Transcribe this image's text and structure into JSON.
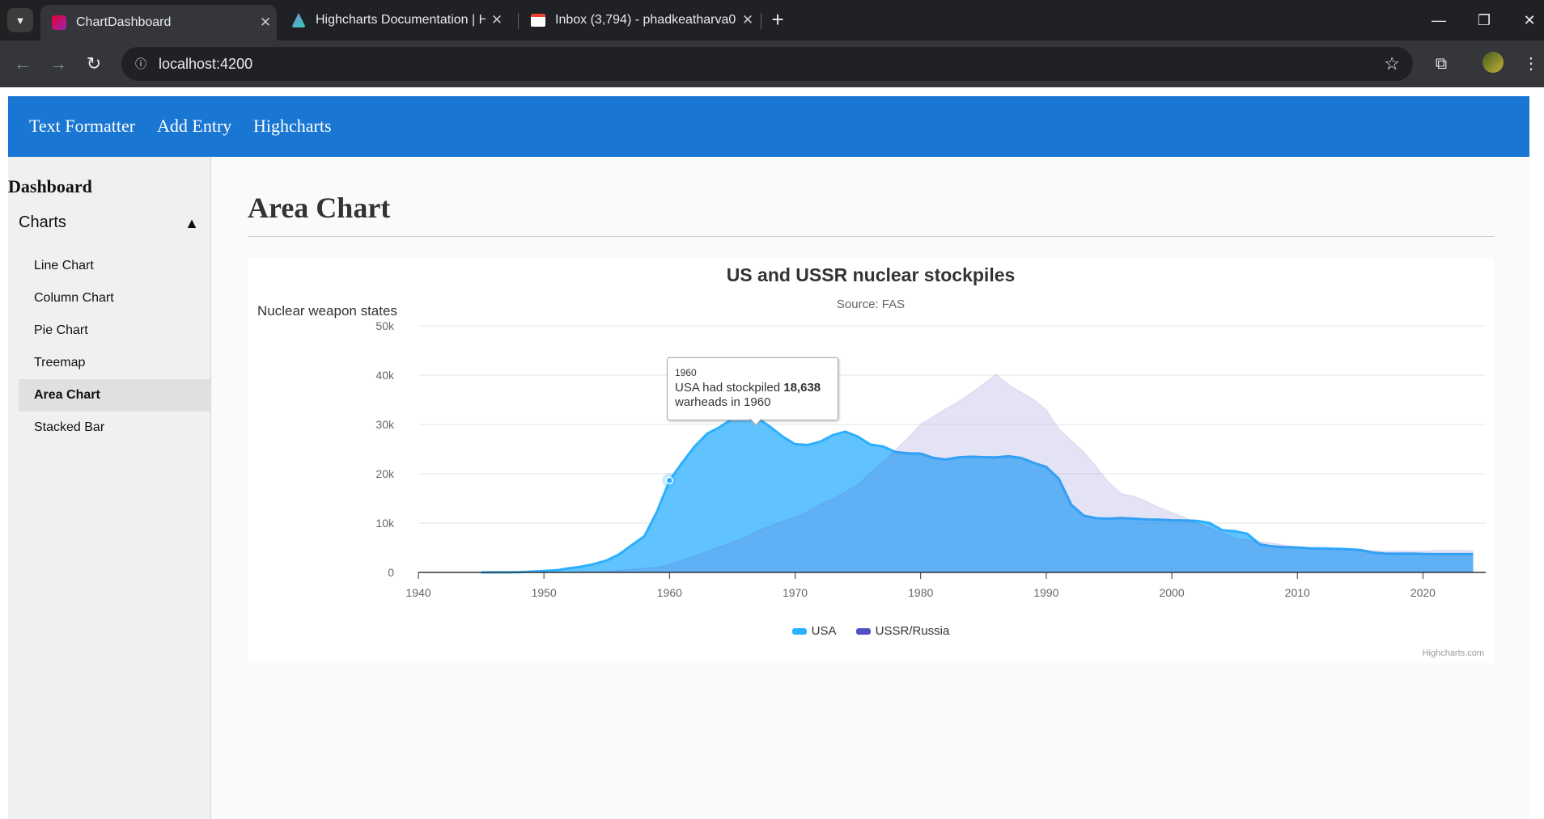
{
  "browser": {
    "tabs": [
      {
        "title": "ChartDashboard",
        "favicon": "angular-icon",
        "active": true
      },
      {
        "title": "Highcharts Documentation | Hi",
        "favicon": "highcharts-icon",
        "active": false
      },
      {
        "title": "Inbox (3,794) - phadkeatharva0",
        "favicon": "gmail-icon",
        "active": false
      }
    ],
    "url": "localhost:4200"
  },
  "nav": {
    "links": [
      "Text Formatter",
      "Add Entry",
      "Highcharts"
    ]
  },
  "sidebar": {
    "title": "Dashboard",
    "section": "Charts",
    "section_caret": "▲",
    "items": [
      {
        "label": "Line Chart"
      },
      {
        "label": "Column Chart"
      },
      {
        "label": "Pie Chart"
      },
      {
        "label": "Treemap"
      },
      {
        "label": "Area Chart",
        "active": true
      },
      {
        "label": "Stacked Bar"
      }
    ]
  },
  "main": {
    "page_title": "Area Chart"
  },
  "tooltip": {
    "header": "1960",
    "line1_prefix": "USA had stockpiled ",
    "line1_value": "18,638",
    "line2": "warheads in 1960"
  },
  "chart_data": {
    "type": "area",
    "title": "US and USSR nuclear stockpiles",
    "subtitle": "Source: FAS",
    "ylabel": "Nuclear weapon states",
    "xlim": [
      1940,
      2025
    ],
    "ylim": [
      0,
      50000
    ],
    "x_ticks": [
      1940,
      1950,
      1960,
      1970,
      1980,
      1990,
      2000,
      2010,
      2020
    ],
    "y_ticks": [
      0,
      10000,
      20000,
      30000,
      40000,
      50000
    ],
    "y_tick_labels": [
      "0",
      "10k",
      "20k",
      "30k",
      "40k",
      "50k"
    ],
    "grid": true,
    "legend": "bottom-center",
    "credits": "Highcharts.com",
    "series": [
      {
        "name": "USA",
        "color": "#2caffe",
        "data": [
          [
            1945,
            2
          ],
          [
            1946,
            9
          ],
          [
            1947,
            13
          ],
          [
            1948,
            50
          ],
          [
            1949,
            170
          ],
          [
            1950,
            298
          ],
          [
            1951,
            438
          ],
          [
            1952,
            841
          ],
          [
            1953,
            1169
          ],
          [
            1954,
            1703
          ],
          [
            1955,
            2422
          ],
          [
            1956,
            3692
          ],
          [
            1957,
            5543
          ],
          [
            1958,
            7345
          ],
          [
            1959,
            12298
          ],
          [
            1960,
            18638
          ],
          [
            1961,
            22229
          ],
          [
            1962,
            25540
          ],
          [
            1963,
            28133
          ],
          [
            1964,
            29463
          ],
          [
            1965,
            31139
          ],
          [
            1966,
            31175
          ],
          [
            1967,
            31255
          ],
          [
            1968,
            29561
          ],
          [
            1969,
            27552
          ],
          [
            1970,
            26008
          ],
          [
            1971,
            25830
          ],
          [
            1972,
            26516
          ],
          [
            1973,
            27835
          ],
          [
            1974,
            28537
          ],
          [
            1975,
            27519
          ],
          [
            1976,
            25914
          ],
          [
            1977,
            25542
          ],
          [
            1978,
            24418
          ],
          [
            1979,
            24138
          ],
          [
            1980,
            24104
          ],
          [
            1981,
            23208
          ],
          [
            1982,
            22886
          ],
          [
            1983,
            23305
          ],
          [
            1984,
            23459
          ],
          [
            1985,
            23368
          ],
          [
            1986,
            23317
          ],
          [
            1987,
            23575
          ],
          [
            1988,
            23205
          ],
          [
            1989,
            22217
          ],
          [
            1990,
            21392
          ],
          [
            1991,
            19008
          ],
          [
            1992,
            13708
          ],
          [
            1993,
            11511
          ],
          [
            1994,
            10979
          ],
          [
            1995,
            10904
          ],
          [
            1996,
            11011
          ],
          [
            1997,
            10903
          ],
          [
            1998,
            10732
          ],
          [
            1999,
            10685
          ],
          [
            2000,
            10577
          ],
          [
            2001,
            10526
          ],
          [
            2002,
            10457
          ],
          [
            2003,
            10027
          ],
          [
            2004,
            8570
          ],
          [
            2005,
            8360
          ],
          [
            2006,
            7853
          ],
          [
            2007,
            5709
          ],
          [
            2008,
            5273
          ],
          [
            2009,
            5113
          ],
          [
            2010,
            5066
          ],
          [
            2011,
            4897
          ],
          [
            2012,
            4881
          ],
          [
            2013,
            4804
          ],
          [
            2014,
            4717
          ],
          [
            2015,
            4571
          ],
          [
            2016,
            4018
          ],
          [
            2017,
            3822
          ],
          [
            2018,
            3785
          ],
          [
            2019,
            3805
          ],
          [
            2020,
            3750
          ],
          [
            2021,
            3708
          ],
          [
            2022,
            3708
          ],
          [
            2023,
            3708
          ],
          [
            2024,
            3708
          ]
        ]
      },
      {
        "name": "USSR/Russia",
        "color": "#544fc5",
        "data": [
          [
            1945,
            0
          ],
          [
            1946,
            0
          ],
          [
            1947,
            0
          ],
          [
            1948,
            0
          ],
          [
            1949,
            1
          ],
          [
            1950,
            5
          ],
          [
            1951,
            25
          ],
          [
            1952,
            50
          ],
          [
            1953,
            120
          ],
          [
            1954,
            150
          ],
          [
            1955,
            200
          ],
          [
            1956,
            426
          ],
          [
            1957,
            660
          ],
          [
            1958,
            863
          ],
          [
            1959,
            1048
          ],
          [
            1960,
            1627
          ],
          [
            1961,
            2492
          ],
          [
            1962,
            3346
          ],
          [
            1963,
            4259
          ],
          [
            1964,
            5242
          ],
          [
            1965,
            6144
          ],
          [
            1966,
            7091
          ],
          [
            1967,
            8400
          ],
          [
            1968,
            9417
          ],
          [
            1969,
            10387
          ],
          [
            1970,
            11269
          ],
          [
            1971,
            12376
          ],
          [
            1972,
            13785
          ],
          [
            1973,
            14970
          ],
          [
            1974,
            16335
          ],
          [
            1975,
            17828
          ],
          [
            1976,
            20175
          ],
          [
            1977,
            22523
          ],
          [
            1978,
            24856
          ],
          [
            1979,
            27314
          ],
          [
            1980,
            30062
          ],
          [
            1981,
            31642
          ],
          [
            1982,
            33141
          ],
          [
            1983,
            34623
          ],
          [
            1984,
            36339
          ],
          [
            1985,
            38212
          ],
          [
            1986,
            40159
          ],
          [
            1987,
            38107
          ],
          [
            1988,
            36538
          ],
          [
            1989,
            35078
          ],
          [
            1990,
            32980
          ],
          [
            1991,
            29154
          ],
          [
            1992,
            26734
          ],
          [
            1993,
            24403
          ],
          [
            1994,
            21339
          ],
          [
            1995,
            18179
          ],
          [
            1996,
            15942
          ],
          [
            1997,
            15442
          ],
          [
            1998,
            14368
          ],
          [
            1999,
            13188
          ],
          [
            2000,
            12188
          ],
          [
            2001,
            11152
          ],
          [
            2002,
            10114
          ],
          [
            2003,
            9076
          ],
          [
            2004,
            8038
          ],
          [
            2005,
            7000
          ],
          [
            2006,
            6643
          ],
          [
            2007,
            6286
          ],
          [
            2008,
            5929
          ],
          [
            2009,
            5527
          ],
          [
            2010,
            5215
          ],
          [
            2011,
            4858
          ],
          [
            2012,
            4750
          ],
          [
            2013,
            4650
          ],
          [
            2014,
            4600
          ],
          [
            2015,
            4500
          ],
          [
            2016,
            4500
          ],
          [
            2017,
            4300
          ],
          [
            2018,
            4350
          ],
          [
            2019,
            4330
          ],
          [
            2020,
            4310
          ],
          [
            2021,
            4495
          ],
          [
            2022,
            4477
          ],
          [
            2023,
            4489
          ],
          [
            2024,
            4380
          ]
        ]
      }
    ]
  }
}
